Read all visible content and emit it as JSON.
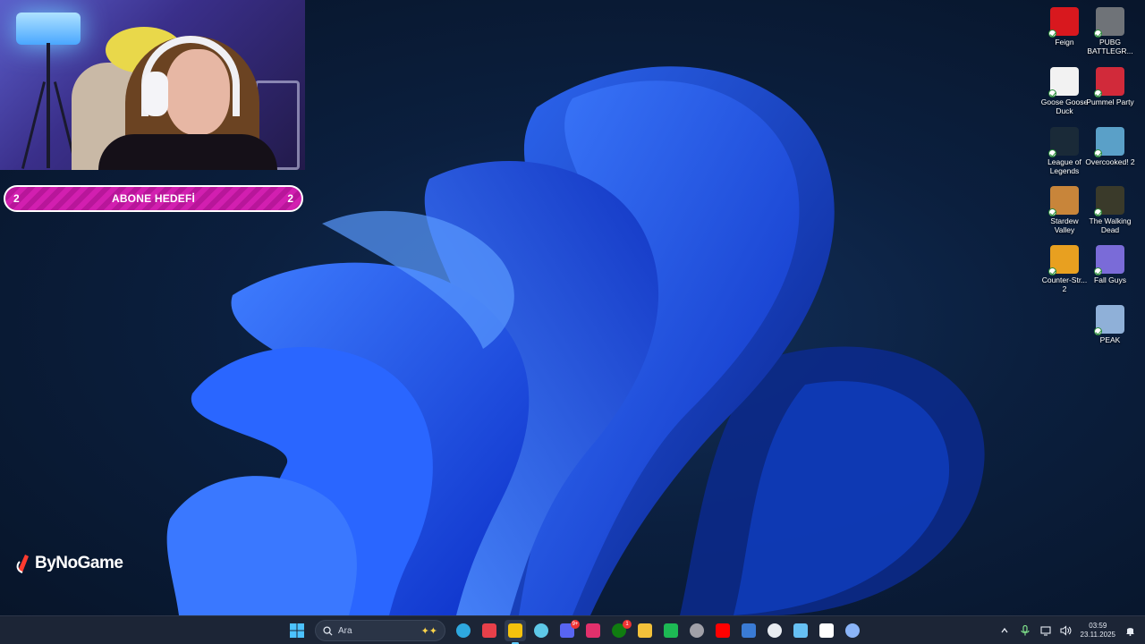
{
  "overlay": {
    "goal": {
      "left_count": "2",
      "label": "ABONE HEDEFİ",
      "right_count": "2"
    },
    "brand": "ByNoGame"
  },
  "desktop_icons": [
    {
      "label": "Feign",
      "icon": "feign-icon",
      "color": "#d8181e"
    },
    {
      "label": "PUBG BATTLEGR...",
      "icon": "pubg-icon",
      "color": "#6f7378"
    },
    {
      "label": "Goose Goose Duck",
      "icon": "goose-goose-duck-icon",
      "color": "#f2f2f2"
    },
    {
      "label": "Pummel Party",
      "icon": "pummel-party-icon",
      "color": "#d12a3a"
    },
    {
      "label": "League of Legends",
      "icon": "league-of-legends-icon",
      "color": "#1a2a38"
    },
    {
      "label": "Overcooked! 2",
      "icon": "overcooked-icon",
      "color": "#5aa0c8"
    },
    {
      "label": "Stardew Valley",
      "icon": "stardew-valley-icon",
      "color": "#c8853a"
    },
    {
      "label": "The Walking Dead",
      "icon": "walking-dead-icon",
      "color": "#3a3a2a"
    },
    {
      "label": "Counter-Str... 2",
      "icon": "counter-strike-icon",
      "color": "#e8a020"
    },
    {
      "label": "Fall Guys",
      "icon": "fall-guys-icon",
      "color": "#7a6bd8"
    },
    {
      "label": "PEAK",
      "icon": "peak-icon",
      "color": "#8fb0d8"
    }
  ],
  "taskbar": {
    "search_placeholder": "Ara",
    "apps": [
      {
        "name": "edge-icon",
        "color": "#2ea8e0"
      },
      {
        "name": "valorant-icon",
        "color": "#e8404a"
      },
      {
        "name": "chrome-icon",
        "color": "#f4c20d",
        "active": true
      },
      {
        "name": "copilot-icon",
        "color": "#5ec8e8"
      },
      {
        "name": "discord-icon",
        "color": "#5865f2",
        "badge": "9+"
      },
      {
        "name": "instagram-icon",
        "color": "#e1306c"
      },
      {
        "name": "xbox-icon",
        "color": "#107c10",
        "badge": "1"
      },
      {
        "name": "file-explorer-icon",
        "color": "#f3c13a"
      },
      {
        "name": "spotify-icon",
        "color": "#1db954"
      },
      {
        "name": "obs-icon",
        "color": "#a0a0a8"
      },
      {
        "name": "youtube-icon",
        "color": "#ff0000"
      },
      {
        "name": "mail-icon",
        "color": "#3a7bd5"
      },
      {
        "name": "notepad-icon",
        "color": "#e8ecf2"
      },
      {
        "name": "steam-icon",
        "color": "#66c0f4"
      },
      {
        "name": "tiktok-icon",
        "color": "#ffffff"
      },
      {
        "name": "settings-app-icon",
        "color": "#8ab4f8"
      }
    ],
    "clock": {
      "time": "03:59",
      "date": "23.11.2025"
    }
  }
}
